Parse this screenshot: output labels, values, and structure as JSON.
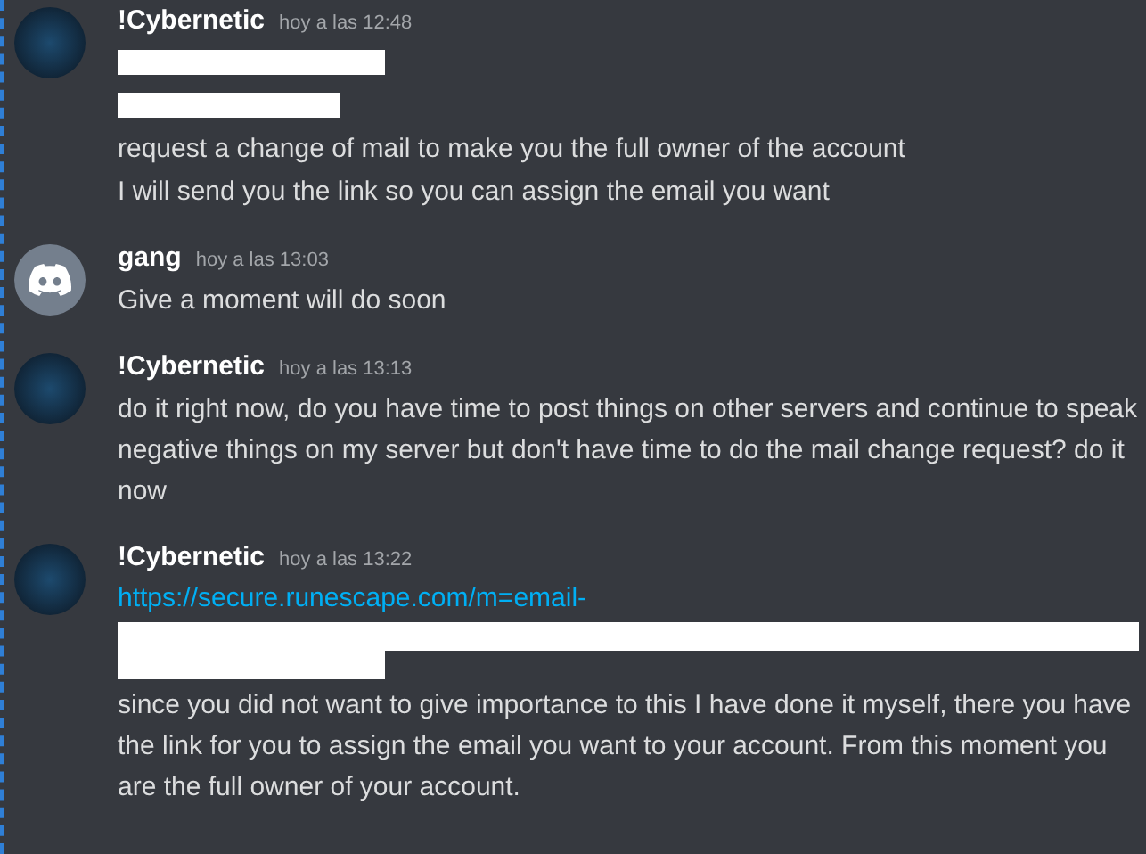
{
  "messages": [
    {
      "kind": "picture",
      "author": "!Cybernetic",
      "time": "hoy a las 12:48",
      "lines": [
        {
          "kind": "redacted"
        },
        {
          "kind": "redacted"
        },
        {
          "kind": "text",
          "text": "request a change of mail to make you the full owner of the account"
        },
        {
          "kind": "text",
          "text": "I will send you the link so you can assign the email you want"
        }
      ]
    },
    {
      "kind": "default",
      "author": "gang",
      "time": "hoy a las 13:03",
      "lines": [
        {
          "kind": "text",
          "text": "Give a moment will do soon"
        }
      ]
    },
    {
      "kind": "picture",
      "author": "!Cybernetic",
      "time": "hoy a las 13:13",
      "lines": [
        {
          "kind": "text",
          "text": "do it right now, do you have time to post things on other servers and continue to speak negative things on my server but don't have time to do the mail change request? do it now"
        }
      ]
    },
    {
      "kind": "picture",
      "author": "!Cybernetic",
      "time": "hoy a las 13:22",
      "lines": [
        {
          "kind": "link",
          "text": "https://secure.runescape.com/m=email-"
        },
        {
          "kind": "redacted"
        },
        {
          "kind": "text",
          "text": "since you did not want to give importance to this I have done it myself, there you have the link for you to assign the email you want to your account. From this moment you are the full owner of your account."
        }
      ]
    }
  ]
}
